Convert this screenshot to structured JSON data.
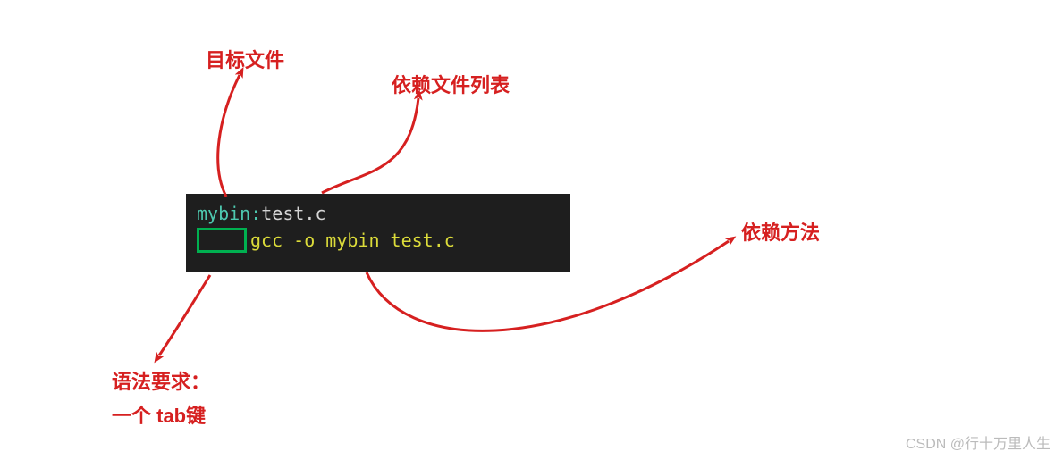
{
  "labels": {
    "target_file": "目标文件",
    "dependency_list": "依赖文件列表",
    "dependency_method": "依赖方法",
    "syntax_req_line1": "语法要求：",
    "syntax_req_line2": "一个 tab键"
  },
  "terminal": {
    "line1_target": "mybin:",
    "line1_deps": "test.c",
    "line2_command": "gcc -o mybin test.c"
  },
  "colors": {
    "annotation": "#d62020",
    "terminal_bg": "#1e1e1e",
    "term_cyan": "#4ec9b0",
    "term_white": "#d4d4d4",
    "term_yellow": "#dcdc3a",
    "tab_border": "#00b050"
  },
  "watermark": "CSDN @行十万里人生"
}
